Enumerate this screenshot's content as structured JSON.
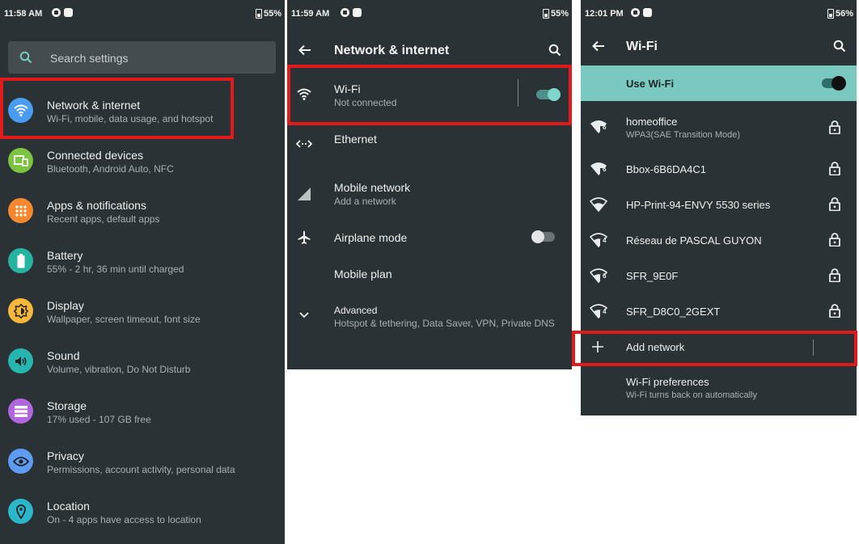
{
  "panel1": {
    "status": {
      "time": "11:58 AM",
      "battery": "55%"
    },
    "search": {
      "placeholder": "Search settings"
    },
    "items": [
      {
        "title": "Network & internet",
        "subtitle": "Wi-Fi, mobile, data usage, and hotspot",
        "icon": "wifi-icon",
        "color": "#4a9cf0"
      },
      {
        "title": "Connected devices",
        "subtitle": "Bluetooth, Android Auto, NFC",
        "icon": "devices-icon",
        "color": "#7cc341"
      },
      {
        "title": "Apps & notifications",
        "subtitle": "Recent apps, default apps",
        "icon": "apps-icon",
        "color": "#f5882e"
      },
      {
        "title": "Battery",
        "subtitle": "55% - 2 hr, 36 min until charged",
        "icon": "battery-icon",
        "color": "#26b3a0"
      },
      {
        "title": "Display",
        "subtitle": "Wallpaper, screen timeout, font size",
        "icon": "display-icon",
        "color": "#f6b73a"
      },
      {
        "title": "Sound",
        "subtitle": "Volume, vibration, Do Not Disturb",
        "icon": "sound-icon",
        "color": "#27b5b0"
      },
      {
        "title": "Storage",
        "subtitle": "17% used - 107 GB free",
        "icon": "storage-icon",
        "color": "#b166e0"
      },
      {
        "title": "Privacy",
        "subtitle": "Permissions, account activity, personal data",
        "icon": "privacy-icon",
        "color": "#5d9cf2"
      },
      {
        "title": "Location",
        "subtitle": "On - 4 apps have access to location",
        "icon": "location-icon",
        "color": "#2bb7c9"
      }
    ]
  },
  "panel2": {
    "status": {
      "time": "11:59 AM",
      "battery": "55%"
    },
    "title": "Network & internet",
    "items": [
      {
        "title": "Wi-Fi",
        "subtitle": "Not connected",
        "icon": "wifi-icon",
        "toggle": "on"
      },
      {
        "title": "Ethernet",
        "subtitle": "",
        "icon": "ethernet-icon"
      },
      {
        "title": "Mobile network",
        "subtitle": "Add a network",
        "icon": "cell-signal-icon"
      },
      {
        "title": "Airplane mode",
        "subtitle": "",
        "icon": "airplane-icon",
        "toggle": "off"
      },
      {
        "title": "Mobile plan",
        "subtitle": "",
        "icon": ""
      },
      {
        "title": "Advanced",
        "subtitle": "Hotspot & tethering, Data Saver, VPN, Private DNS",
        "icon": "chevron-down-icon"
      }
    ]
  },
  "panel3": {
    "status": {
      "time": "12:01 PM",
      "battery": "56%"
    },
    "title": "Wi-Fi",
    "use_wifi": {
      "label": "Use Wi-Fi",
      "toggle": "on"
    },
    "networks": [
      {
        "name": "homeoffice",
        "subtitle": "WPA3(SAE Transition Mode)",
        "badge": "6"
      },
      {
        "name": "Bbox-6B6DA4C1",
        "subtitle": "",
        "badge": "6"
      },
      {
        "name": "HP-Print-94-ENVY 5530 series",
        "subtitle": "",
        "badge": ""
      },
      {
        "name": "Réseau de PASCAL GUYON",
        "subtitle": "",
        "badge": "4"
      },
      {
        "name": "SFR_9E0F",
        "subtitle": "",
        "badge": "6"
      },
      {
        "name": "SFR_D8C0_2GEXT",
        "subtitle": "",
        "badge": "4"
      }
    ],
    "add_network": "Add network",
    "preferences": {
      "title": "Wi-Fi preferences",
      "subtitle": "Wi-Fi turns back on automatically"
    }
  },
  "colors": {
    "background": "#2b3235",
    "accent": "#79c9c0",
    "highlight": "#e11b1b"
  }
}
